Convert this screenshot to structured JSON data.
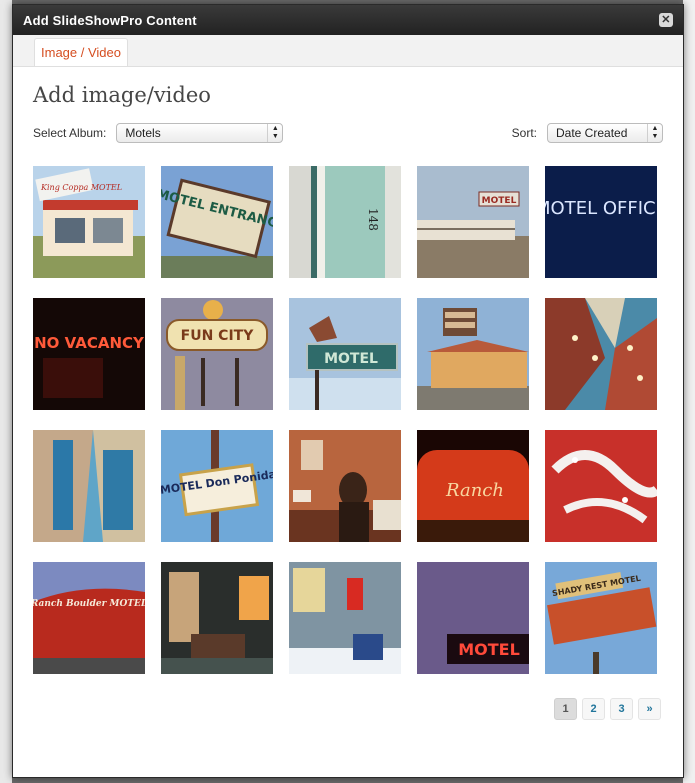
{
  "window": {
    "title": "Add SlideShowPro Content"
  },
  "tabs": [
    {
      "label": "Image / Video"
    }
  ],
  "page": {
    "title": "Add image/video"
  },
  "controls": {
    "album_label": "Select Album:",
    "album_value": "Motels",
    "sort_label": "Sort:",
    "sort_value": "Date Created"
  },
  "thumbnails": [
    {
      "text": "King Coppa MOTEL"
    },
    {
      "text": "MOTEL ENTRANCE"
    },
    {
      "text": "148"
    },
    {
      "text": "MOTEL"
    },
    {
      "text": "MOTEL OFFICE"
    },
    {
      "text": "NO VACANCY"
    },
    {
      "text": "FUN CITY"
    },
    {
      "text": "MOTEL"
    },
    {
      "text": ""
    },
    {
      "text": ""
    },
    {
      "text": ""
    },
    {
      "text": "MOTEL Don Ponida"
    },
    {
      "text": ""
    },
    {
      "text": "Ranch"
    },
    {
      "text": ""
    },
    {
      "text": "Ranch Boulder MOTEL"
    },
    {
      "text": ""
    },
    {
      "text": ""
    },
    {
      "text": "MOTEL"
    },
    {
      "text": "SHADY REST MOTEL"
    }
  ],
  "pagination": {
    "pages": [
      "1",
      "2",
      "3"
    ],
    "next": "»",
    "current": "1"
  },
  "colors": {
    "accent": "#d54e21",
    "link": "#21759b"
  }
}
